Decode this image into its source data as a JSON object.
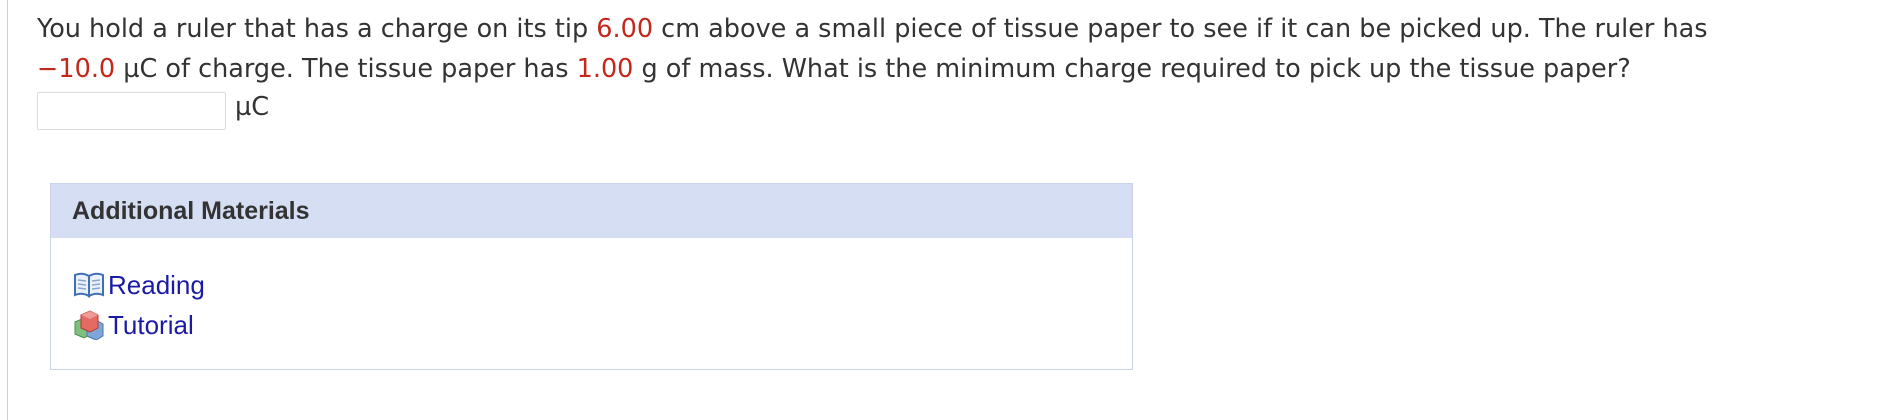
{
  "question": {
    "t1": "You hold a ruler that has a charge on its tip ",
    "distance": "6.00",
    "t2": " cm above a small piece of tissue paper to see if it can be picked up. The ruler has",
    "charge": "−10.0",
    "t3": " µC of charge. The tissue paper has ",
    "mass": "1.00",
    "t4": " g of mass. What is the minimum charge required to pick up the tissue paper?"
  },
  "answer": {
    "value": "",
    "unit": "µC"
  },
  "materials": {
    "title": "Additional Materials",
    "items": [
      {
        "label": "Reading",
        "icon": "book-icon"
      },
      {
        "label": "Tutorial",
        "icon": "tutorial-icon"
      }
    ]
  },
  "colors": {
    "highlight": "#c4271b",
    "link": "#1a1aa6",
    "panel_header": "#d5def3"
  }
}
